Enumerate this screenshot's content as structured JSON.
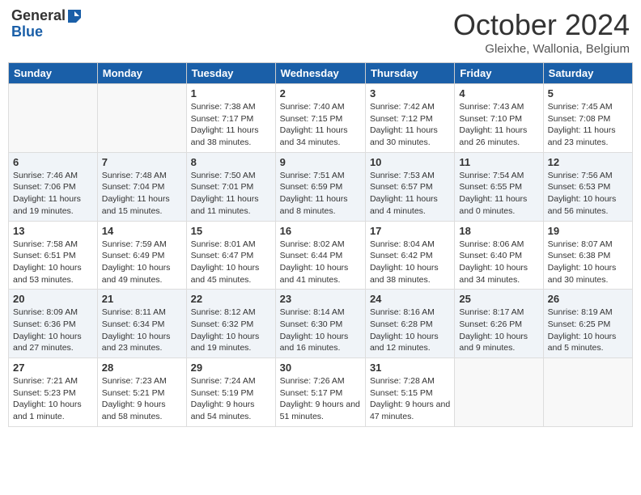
{
  "header": {
    "logo_general": "General",
    "logo_blue": "Blue",
    "month": "October 2024",
    "location": "Gleixhe, Wallonia, Belgium"
  },
  "days_of_week": [
    "Sunday",
    "Monday",
    "Tuesday",
    "Wednesday",
    "Thursday",
    "Friday",
    "Saturday"
  ],
  "weeks": [
    [
      {
        "day": "",
        "sunrise": "",
        "sunset": "",
        "daylight": "",
        "empty": true
      },
      {
        "day": "",
        "sunrise": "",
        "sunset": "",
        "daylight": "",
        "empty": true
      },
      {
        "day": "1",
        "sunrise": "Sunrise: 7:38 AM",
        "sunset": "Sunset: 7:17 PM",
        "daylight": "Daylight: 11 hours and 38 minutes."
      },
      {
        "day": "2",
        "sunrise": "Sunrise: 7:40 AM",
        "sunset": "Sunset: 7:15 PM",
        "daylight": "Daylight: 11 hours and 34 minutes."
      },
      {
        "day": "3",
        "sunrise": "Sunrise: 7:42 AM",
        "sunset": "Sunset: 7:12 PM",
        "daylight": "Daylight: 11 hours and 30 minutes."
      },
      {
        "day": "4",
        "sunrise": "Sunrise: 7:43 AM",
        "sunset": "Sunset: 7:10 PM",
        "daylight": "Daylight: 11 hours and 26 minutes."
      },
      {
        "day": "5",
        "sunrise": "Sunrise: 7:45 AM",
        "sunset": "Sunset: 7:08 PM",
        "daylight": "Daylight: 11 hours and 23 minutes."
      }
    ],
    [
      {
        "day": "6",
        "sunrise": "Sunrise: 7:46 AM",
        "sunset": "Sunset: 7:06 PM",
        "daylight": "Daylight: 11 hours and 19 minutes."
      },
      {
        "day": "7",
        "sunrise": "Sunrise: 7:48 AM",
        "sunset": "Sunset: 7:04 PM",
        "daylight": "Daylight: 11 hours and 15 minutes."
      },
      {
        "day": "8",
        "sunrise": "Sunrise: 7:50 AM",
        "sunset": "Sunset: 7:01 PM",
        "daylight": "Daylight: 11 hours and 11 minutes."
      },
      {
        "day": "9",
        "sunrise": "Sunrise: 7:51 AM",
        "sunset": "Sunset: 6:59 PM",
        "daylight": "Daylight: 11 hours and 8 minutes."
      },
      {
        "day": "10",
        "sunrise": "Sunrise: 7:53 AM",
        "sunset": "Sunset: 6:57 PM",
        "daylight": "Daylight: 11 hours and 4 minutes."
      },
      {
        "day": "11",
        "sunrise": "Sunrise: 7:54 AM",
        "sunset": "Sunset: 6:55 PM",
        "daylight": "Daylight: 11 hours and 0 minutes."
      },
      {
        "day": "12",
        "sunrise": "Sunrise: 7:56 AM",
        "sunset": "Sunset: 6:53 PM",
        "daylight": "Daylight: 10 hours and 56 minutes."
      }
    ],
    [
      {
        "day": "13",
        "sunrise": "Sunrise: 7:58 AM",
        "sunset": "Sunset: 6:51 PM",
        "daylight": "Daylight: 10 hours and 53 minutes."
      },
      {
        "day": "14",
        "sunrise": "Sunrise: 7:59 AM",
        "sunset": "Sunset: 6:49 PM",
        "daylight": "Daylight: 10 hours and 49 minutes."
      },
      {
        "day": "15",
        "sunrise": "Sunrise: 8:01 AM",
        "sunset": "Sunset: 6:47 PM",
        "daylight": "Daylight: 10 hours and 45 minutes."
      },
      {
        "day": "16",
        "sunrise": "Sunrise: 8:02 AM",
        "sunset": "Sunset: 6:44 PM",
        "daylight": "Daylight: 10 hours and 41 minutes."
      },
      {
        "day": "17",
        "sunrise": "Sunrise: 8:04 AM",
        "sunset": "Sunset: 6:42 PM",
        "daylight": "Daylight: 10 hours and 38 minutes."
      },
      {
        "day": "18",
        "sunrise": "Sunrise: 8:06 AM",
        "sunset": "Sunset: 6:40 PM",
        "daylight": "Daylight: 10 hours and 34 minutes."
      },
      {
        "day": "19",
        "sunrise": "Sunrise: 8:07 AM",
        "sunset": "Sunset: 6:38 PM",
        "daylight": "Daylight: 10 hours and 30 minutes."
      }
    ],
    [
      {
        "day": "20",
        "sunrise": "Sunrise: 8:09 AM",
        "sunset": "Sunset: 6:36 PM",
        "daylight": "Daylight: 10 hours and 27 minutes."
      },
      {
        "day": "21",
        "sunrise": "Sunrise: 8:11 AM",
        "sunset": "Sunset: 6:34 PM",
        "daylight": "Daylight: 10 hours and 23 minutes."
      },
      {
        "day": "22",
        "sunrise": "Sunrise: 8:12 AM",
        "sunset": "Sunset: 6:32 PM",
        "daylight": "Daylight: 10 hours and 19 minutes."
      },
      {
        "day": "23",
        "sunrise": "Sunrise: 8:14 AM",
        "sunset": "Sunset: 6:30 PM",
        "daylight": "Daylight: 10 hours and 16 minutes."
      },
      {
        "day": "24",
        "sunrise": "Sunrise: 8:16 AM",
        "sunset": "Sunset: 6:28 PM",
        "daylight": "Daylight: 10 hours and 12 minutes."
      },
      {
        "day": "25",
        "sunrise": "Sunrise: 8:17 AM",
        "sunset": "Sunset: 6:26 PM",
        "daylight": "Daylight: 10 hours and 9 minutes."
      },
      {
        "day": "26",
        "sunrise": "Sunrise: 8:19 AM",
        "sunset": "Sunset: 6:25 PM",
        "daylight": "Daylight: 10 hours and 5 minutes."
      }
    ],
    [
      {
        "day": "27",
        "sunrise": "Sunrise: 7:21 AM",
        "sunset": "Sunset: 5:23 PM",
        "daylight": "Daylight: 10 hours and 1 minute."
      },
      {
        "day": "28",
        "sunrise": "Sunrise: 7:23 AM",
        "sunset": "Sunset: 5:21 PM",
        "daylight": "Daylight: 9 hours and 58 minutes."
      },
      {
        "day": "29",
        "sunrise": "Sunrise: 7:24 AM",
        "sunset": "Sunset: 5:19 PM",
        "daylight": "Daylight: 9 hours and 54 minutes."
      },
      {
        "day": "30",
        "sunrise": "Sunrise: 7:26 AM",
        "sunset": "Sunset: 5:17 PM",
        "daylight": "Daylight: 9 hours and 51 minutes."
      },
      {
        "day": "31",
        "sunrise": "Sunrise: 7:28 AM",
        "sunset": "Sunset: 5:15 PM",
        "daylight": "Daylight: 9 hours and 47 minutes."
      },
      {
        "day": "",
        "sunrise": "",
        "sunset": "",
        "daylight": "",
        "empty": true
      },
      {
        "day": "",
        "sunrise": "",
        "sunset": "",
        "daylight": "",
        "empty": true
      }
    ]
  ]
}
